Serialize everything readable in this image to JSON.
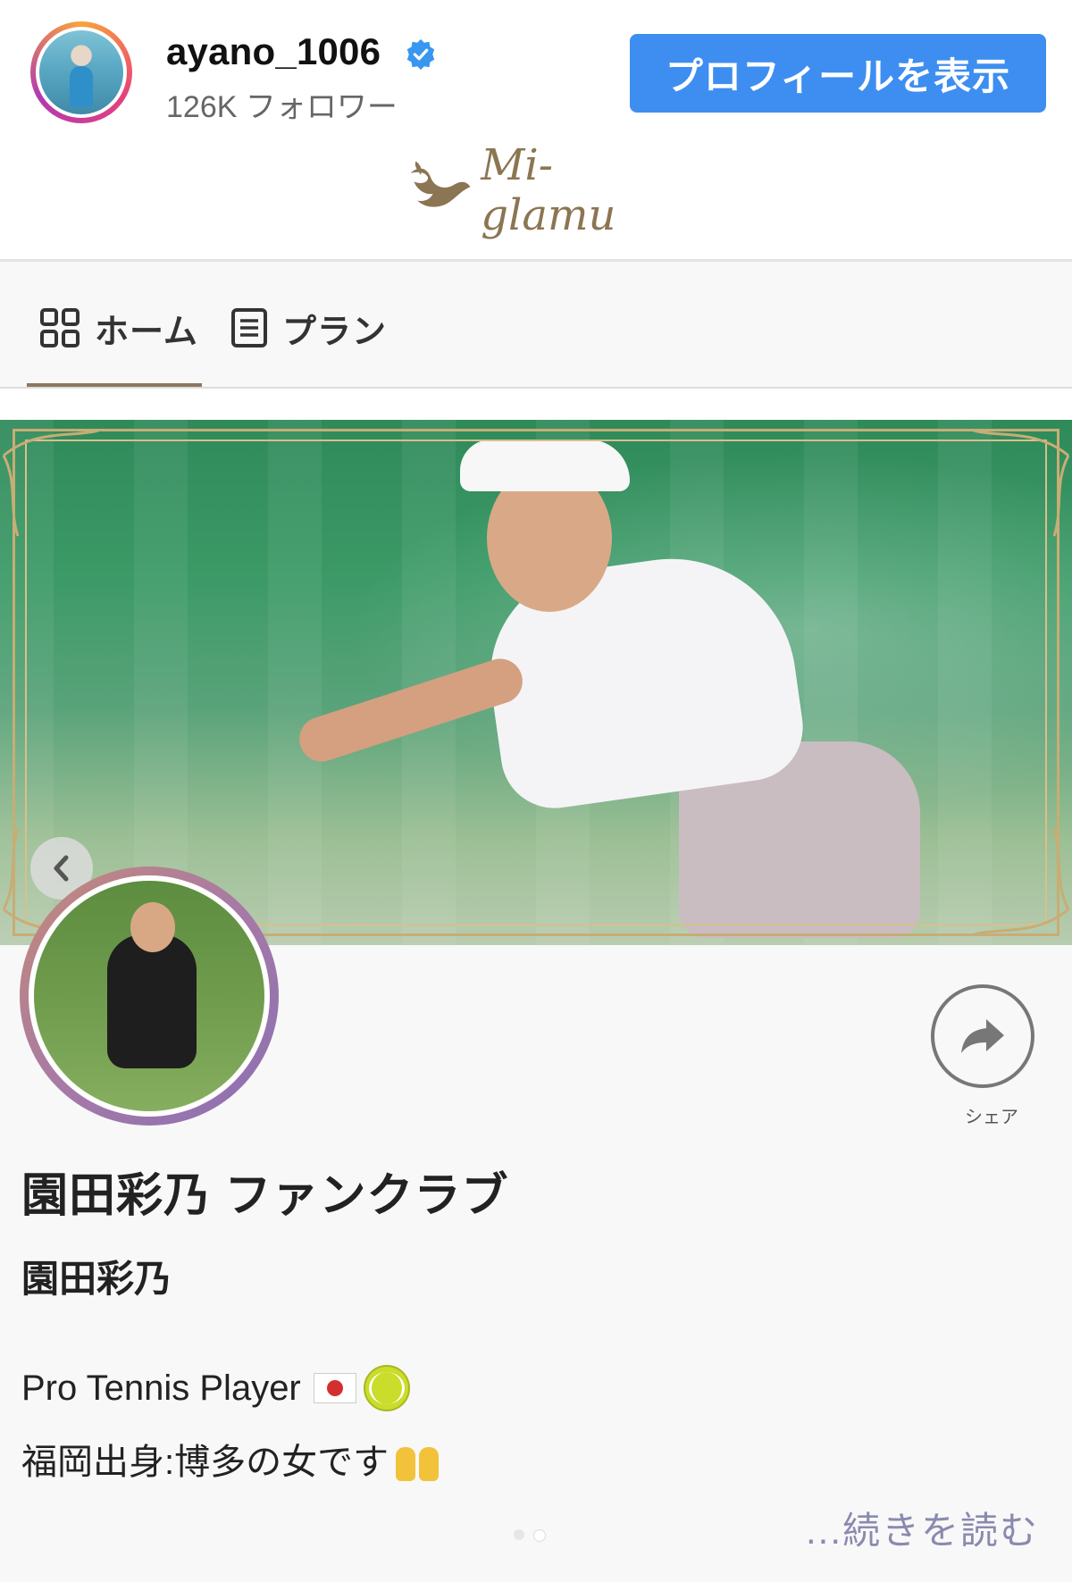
{
  "header": {
    "username": "ayano_1006",
    "followers": "126K フォロワー",
    "profile_button": "プロフィールを表示"
  },
  "brand": {
    "name": "Mi-glamu"
  },
  "tabs": [
    {
      "label": "ホーム",
      "icon": "grid-icon",
      "active": true
    },
    {
      "label": "プラン",
      "icon": "document-icon",
      "active": false
    }
  ],
  "banner": {
    "prev_icon": "chevron-left-icon"
  },
  "profile": {
    "club_name": "園田彩乃 ファンクラブ",
    "owner_name": "園田彩乃",
    "bio_line1": "Pro Tennis Player",
    "bio_line2": "福岡出身:博多の女です",
    "read_more": "...続きを読む",
    "share_label": "シェア"
  },
  "colors": {
    "accent_button": "#3d8ef0",
    "brand_gold": "#8c7552",
    "tab_underline": "#8c7760",
    "verified_blue": "#3897f0"
  }
}
